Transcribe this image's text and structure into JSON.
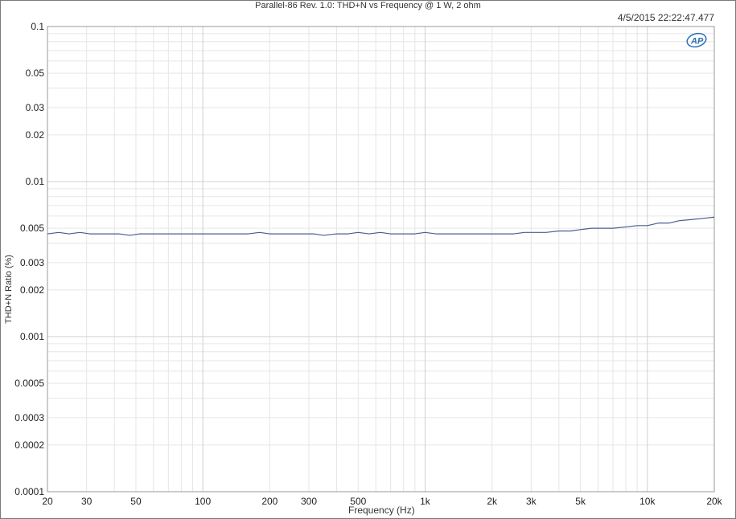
{
  "chart_data": {
    "type": "line",
    "title": "Parallel-86 Rev. 1.0: THD+N vs Frequency @ 1 W, 2 ohm",
    "timestamp": "4/5/2015 22:22:47.477",
    "xlabel": "Frequency (Hz)",
    "ylabel": "THD+N Ratio (%)",
    "x_scale": "log",
    "y_scale": "log",
    "xlim": [
      20,
      20000
    ],
    "ylim": [
      0.0001,
      0.1
    ],
    "grid": true,
    "x_ticks": [
      {
        "value": 20,
        "label": "20"
      },
      {
        "value": 30,
        "label": "30"
      },
      {
        "value": 50,
        "label": "50"
      },
      {
        "value": 100,
        "label": "100"
      },
      {
        "value": 200,
        "label": "200"
      },
      {
        "value": 300,
        "label": "300"
      },
      {
        "value": 500,
        "label": "500"
      },
      {
        "value": 1000,
        "label": "1k"
      },
      {
        "value": 2000,
        "label": "2k"
      },
      {
        "value": 3000,
        "label": "3k"
      },
      {
        "value": 5000,
        "label": "5k"
      },
      {
        "value": 10000,
        "label": "10k"
      },
      {
        "value": 20000,
        "label": "20k"
      }
    ],
    "y_ticks": [
      {
        "value": 0.1,
        "label": "0.1"
      },
      {
        "value": 0.05,
        "label": "0.05"
      },
      {
        "value": 0.03,
        "label": "0.03"
      },
      {
        "value": 0.02,
        "label": "0.02"
      },
      {
        "value": 0.01,
        "label": "0.01"
      },
      {
        "value": 0.005,
        "label": "0.005"
      },
      {
        "value": 0.003,
        "label": "0.003"
      },
      {
        "value": 0.002,
        "label": "0.002"
      },
      {
        "value": 0.001,
        "label": "0.001"
      },
      {
        "value": 0.0005,
        "label": "0.0005"
      },
      {
        "value": 0.0003,
        "label": "0.0003"
      },
      {
        "value": 0.0002,
        "label": "0.0002"
      },
      {
        "value": 0.0001,
        "label": "0.0001"
      }
    ],
    "series": [
      {
        "color": "#4a5f8c",
        "x": [
          20,
          22.5,
          25,
          28,
          31,
          34,
          38,
          42,
          47,
          52,
          58,
          65,
          72,
          80,
          90,
          100,
          112,
          125,
          140,
          160,
          180,
          200,
          225,
          250,
          280,
          315,
          350,
          400,
          450,
          500,
          560,
          630,
          700,
          800,
          900,
          1000,
          1120,
          1250,
          1400,
          1600,
          1800,
          2000,
          2250,
          2500,
          2800,
          3150,
          3500,
          4000,
          4500,
          5000,
          5600,
          6300,
          7000,
          8000,
          9000,
          10000,
          11200,
          12500,
          14000,
          16000,
          18000,
          20000
        ],
        "y": [
          0.0046,
          0.0047,
          0.0046,
          0.0047,
          0.0046,
          0.0046,
          0.0046,
          0.0046,
          0.0045,
          0.0046,
          0.0046,
          0.0046,
          0.0046,
          0.0046,
          0.0046,
          0.0046,
          0.0046,
          0.0046,
          0.0046,
          0.0046,
          0.0047,
          0.0046,
          0.0046,
          0.0046,
          0.0046,
          0.0046,
          0.0045,
          0.0046,
          0.0046,
          0.0047,
          0.0046,
          0.0047,
          0.0046,
          0.0046,
          0.0046,
          0.0047,
          0.0046,
          0.0046,
          0.0046,
          0.0046,
          0.0046,
          0.0046,
          0.0046,
          0.0046,
          0.0047,
          0.0047,
          0.0047,
          0.0048,
          0.0048,
          0.0049,
          0.005,
          0.005,
          0.005,
          0.0051,
          0.0052,
          0.0052,
          0.0054,
          0.0054,
          0.0056,
          0.0057,
          0.0058,
          0.0059
        ]
      }
    ]
  }
}
